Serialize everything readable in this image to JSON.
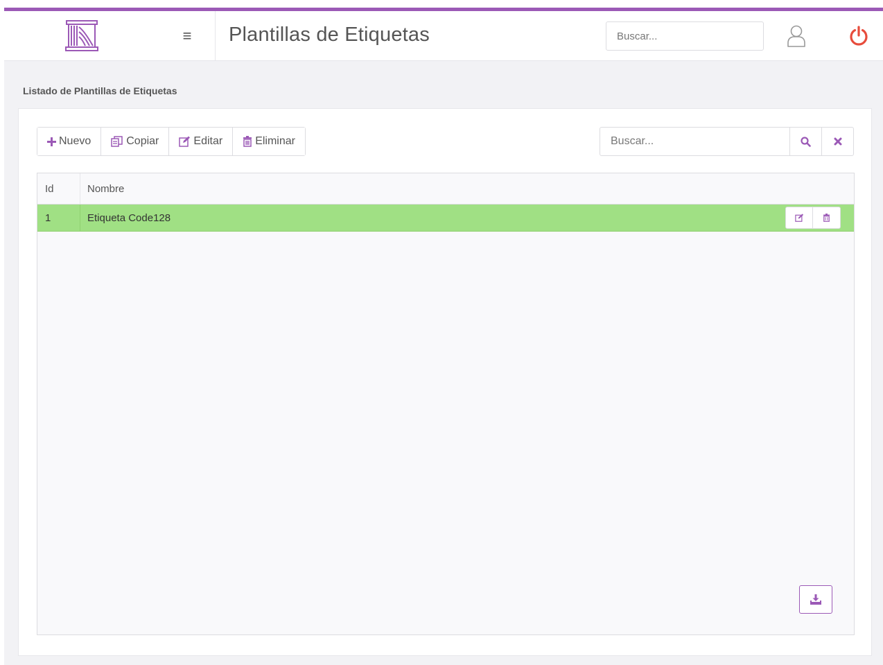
{
  "header": {
    "title": "Plantillas de Etiquetas",
    "search_placeholder": "Buscar...",
    "logo_icon": "column-logo-icon",
    "menu_icon": "hamburger-icon",
    "user_icon": "user-icon",
    "power_icon": "power-icon",
    "menu_symbol": "≡"
  },
  "colors": {
    "accent": "#9b59b6",
    "selected_row": "#a0e084",
    "power": "#e74c3c",
    "background": "#f2f2f5"
  },
  "section": {
    "title": "Listado de Plantillas de Etiquetas"
  },
  "toolbar": {
    "buttons": [
      {
        "label": "Nuevo",
        "icon": "plus-icon"
      },
      {
        "label": "Copiar",
        "icon": "copy-icon"
      },
      {
        "label": "Editar",
        "icon": "edit-icon"
      },
      {
        "label": "Eliminar",
        "icon": "trash-icon"
      }
    ],
    "search_placeholder": "Buscar...",
    "search_icon": "search-icon",
    "clear_icon": "close-icon"
  },
  "grid": {
    "columns": [
      "Id",
      "Nombre"
    ],
    "rows": [
      {
        "id": "1",
        "nombre": "Etiqueta Code128",
        "selected": true
      }
    ],
    "row_actions": [
      "edit-icon",
      "trash-icon"
    ],
    "export_icon": "download-icon"
  }
}
